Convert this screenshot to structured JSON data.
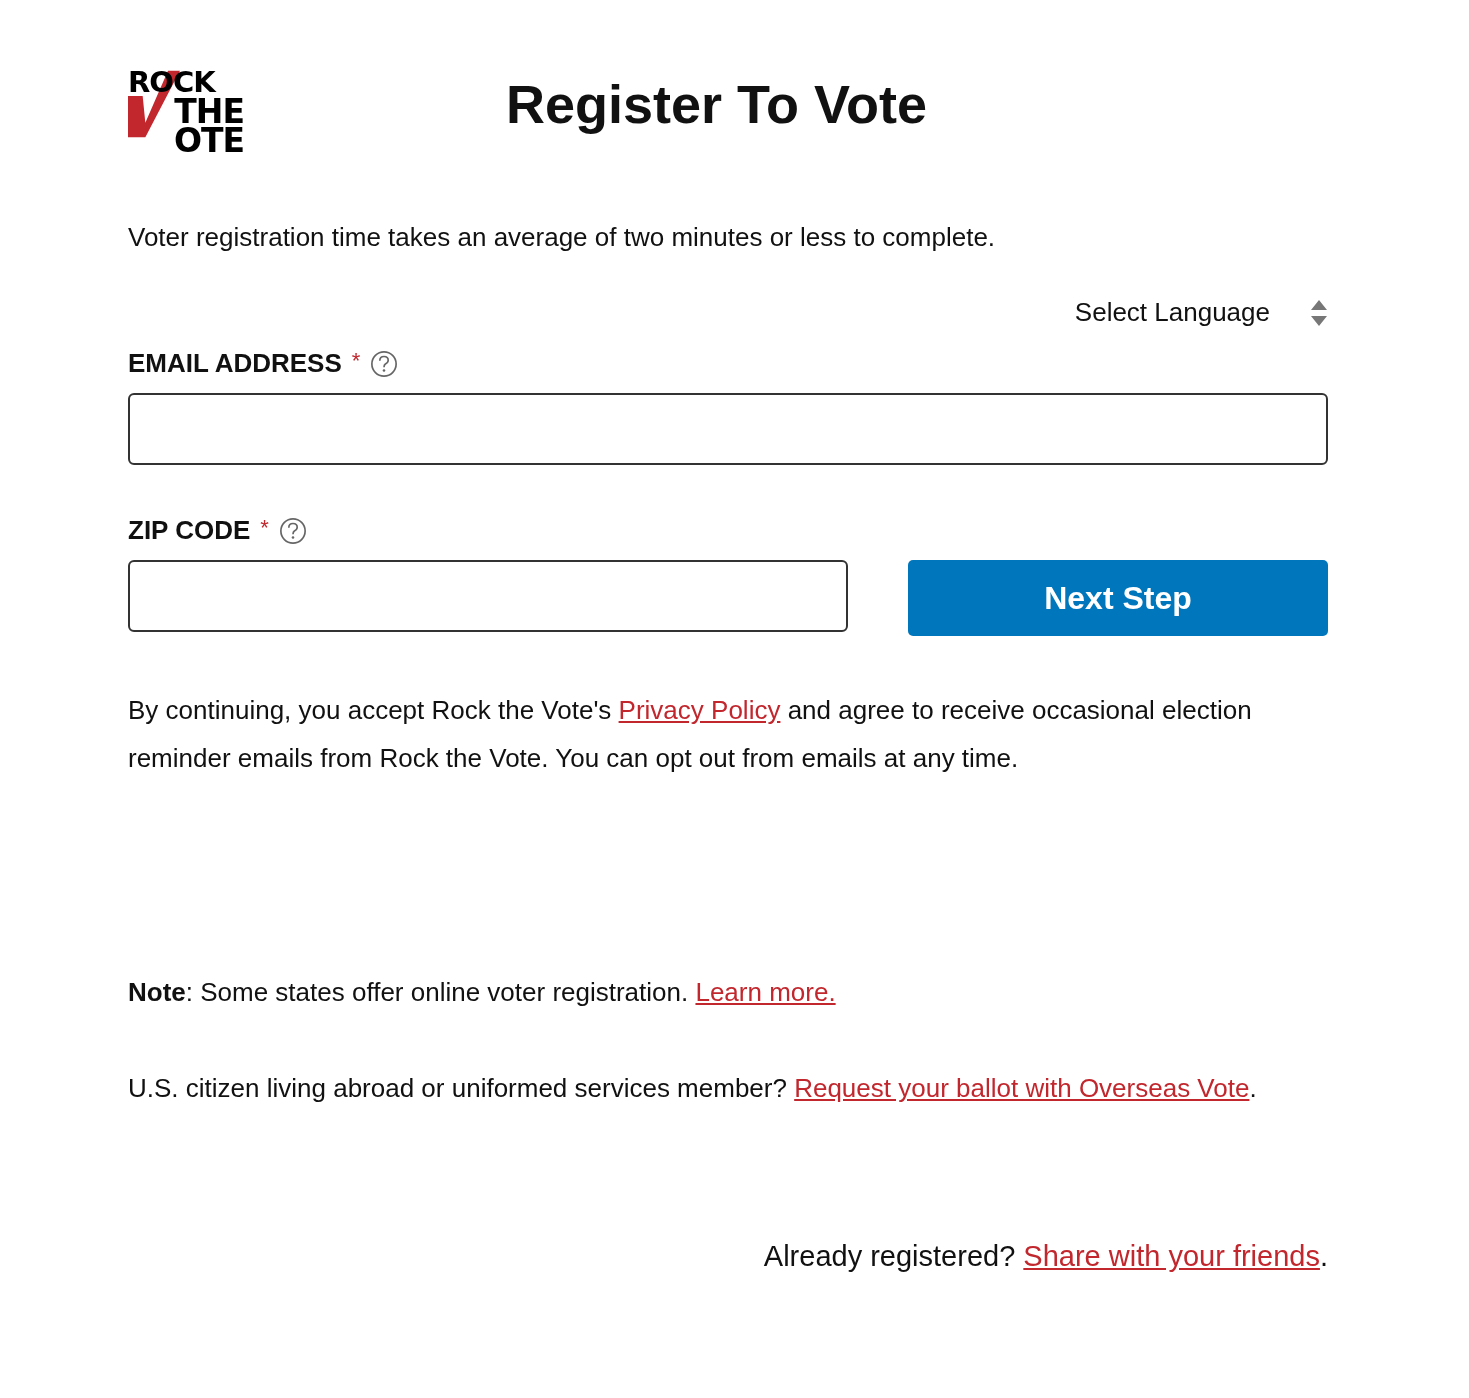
{
  "logo": {
    "lines": [
      "ROCK",
      "THE",
      "OTE"
    ]
  },
  "title": "Register To Vote",
  "intro": "Voter registration time takes an average of two minutes or less to complete.",
  "language_select": {
    "value": "Select Language"
  },
  "fields": [
    {
      "label": "EMAIL ADDRESS",
      "required_mark": "*",
      "kind": "wide"
    },
    {
      "label": "ZIP CODE",
      "required_mark": "*",
      "kind": "half"
    }
  ],
  "next_button": "Next Step",
  "consent": {
    "before": "By continuing, you accept Rock the Vote's ",
    "link": "Privacy Policy",
    "after": " and agree to receive occasional election reminder emails from Rock the Vote. You can opt out from emails at any time."
  },
  "note": {
    "before": "**Note**: Some states offer online voter registration. ",
    "link": "Learn more."
  },
  "overseas": {
    "before": "U.S. citizen living abroad or uniformed services member? ",
    "link": "Request your ballot with Overseas Vote",
    "after": "."
  },
  "share": {
    "before": "Already registered? ",
    "link": "Share with your friends",
    "after": "."
  }
}
